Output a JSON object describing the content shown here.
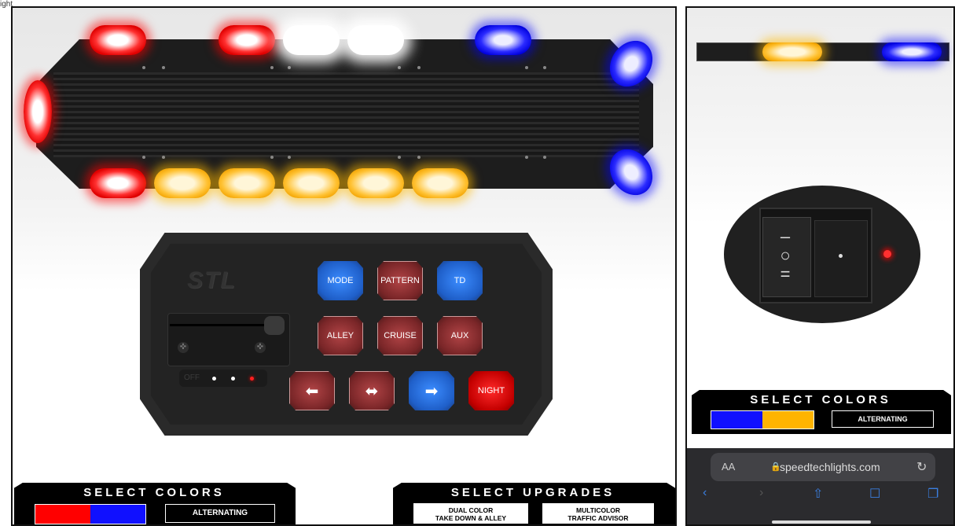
{
  "caption": "ight",
  "left_panel": {
    "controller": {
      "logo": "STL",
      "off_label": "OFF",
      "buttons": {
        "mode": "MODE",
        "pattern": "PATTERN",
        "td": "TD",
        "alley": "ALLEY",
        "cruise": "CRUISE",
        "aux": "AUX",
        "left_arrow": "⬅",
        "both_arrow": "⬌",
        "right_arrow": "➡",
        "night": "NIGHT"
      }
    },
    "select_colors": {
      "title": "SELECT COLORS",
      "swatch_colors": [
        "#ff0000",
        "#1010ff"
      ],
      "option_label": "ALTERNATING"
    },
    "select_upgrades": {
      "title": "SELECT UPGRADES",
      "option1_line1": "DUAL COLOR",
      "option1_line2": "TAKE DOWN & ALLEY",
      "option2_line1": "MULTICOLOR",
      "option2_line2": "TRAFFIC ADVISOR"
    }
  },
  "right_panel": {
    "select_colors": {
      "title": "SELECT COLORS",
      "swatch_colors": [
        "#1010ff",
        "#ffb400"
      ],
      "option_label": "ALTERNATING"
    },
    "browser": {
      "aa_label": "AA",
      "url": "speedtechlights.com",
      "icons": [
        "back-icon",
        "forward-icon",
        "share-icon",
        "bookmarks-icon",
        "tabs-icon",
        "reload-icon",
        "lock-icon"
      ]
    }
  }
}
